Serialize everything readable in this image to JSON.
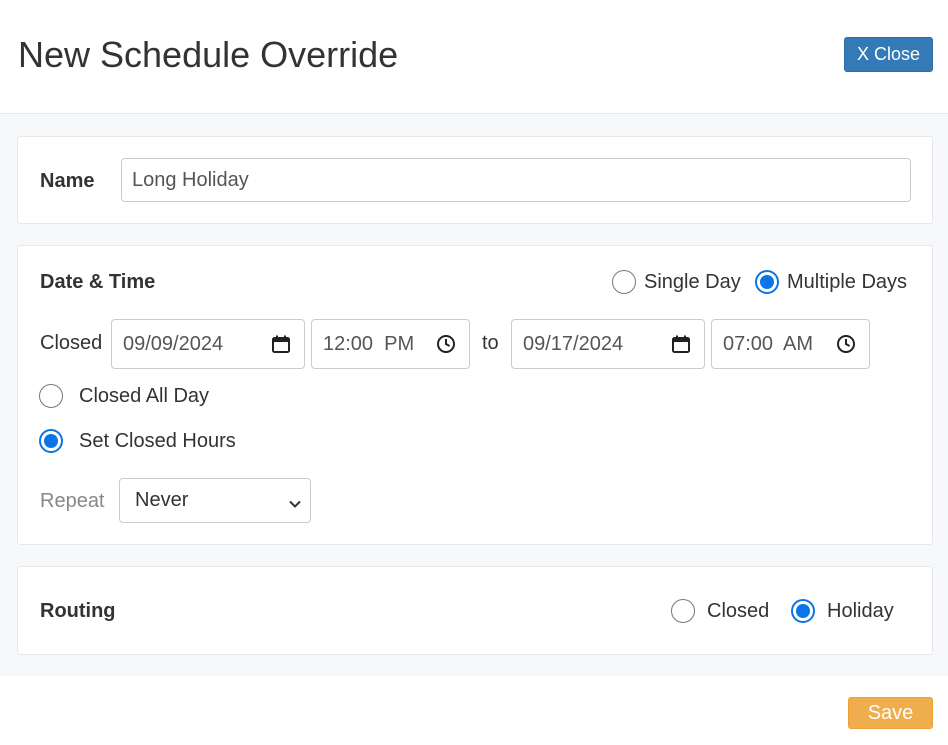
{
  "header": {
    "title": "New Schedule Override",
    "close_label": "X Close"
  },
  "name_section": {
    "label": "Name",
    "value": "Long Holiday"
  },
  "datetime_section": {
    "label": "Date & Time",
    "mode_options": [
      {
        "label": "Single Day",
        "checked": false
      },
      {
        "label": "Multiple Days",
        "checked": true
      }
    ],
    "closed_label": "Closed",
    "start_date": "09/09/2024",
    "start_time": "12:00  PM",
    "to_label": "to",
    "end_date": "09/17/2024",
    "end_time": "07:00  AM",
    "hours_options": [
      {
        "label": "Closed All Day",
        "checked": false
      },
      {
        "label": "Set Closed Hours",
        "checked": true
      }
    ],
    "repeat_label": "Repeat",
    "repeat_value": "Never"
  },
  "routing_section": {
    "label": "Routing",
    "options": [
      {
        "label": "Closed",
        "checked": false
      },
      {
        "label": "Holiday",
        "checked": true
      }
    ]
  },
  "footer": {
    "save_label": "Save"
  },
  "colors": {
    "primary": "#337ab7",
    "warning": "#f0ad4e",
    "radio_accent": "#0b74e6"
  }
}
